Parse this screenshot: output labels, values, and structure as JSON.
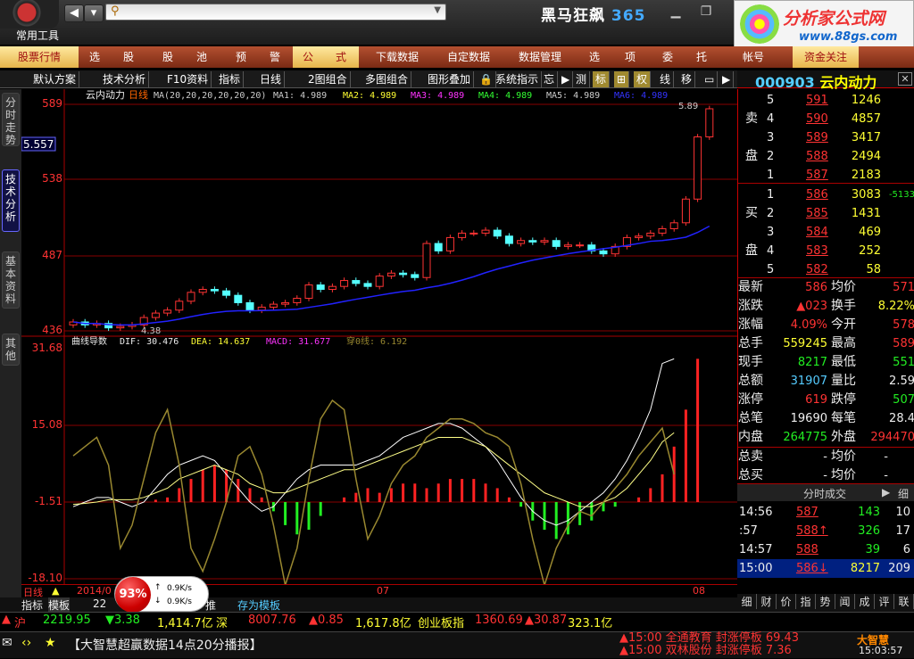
{
  "titlebar": {
    "common_tools": "常用工具",
    "brand_a": "黑马狂飙",
    "brand_b": "365",
    "site_name": "分析家公式网",
    "site_url": "www.88gs.com"
  },
  "menu": [
    "股票行情",
    "选",
    "股",
    "股",
    "池",
    "预",
    "警",
    "公",
    "式",
    "下载数据",
    "自定数据",
    "数据管理",
    "选",
    "项",
    "委",
    "托",
    "帐号",
    "资金关注"
  ],
  "toolbar": [
    "默认方案",
    "技术分析",
    "F10资料",
    "指标",
    "日线",
    "2图组合",
    "多图组合",
    "图形叠加",
    "系统指示",
    "忘",
    "测",
    "标",
    "权",
    "线",
    "移"
  ],
  "left_tabs": [
    "分时走势",
    "技术分析",
    "基本资料",
    "其他"
  ],
  "chart": {
    "name": "云内动力",
    "period": "日线",
    "cursor_price": "5.557",
    "ma_line": [
      "MA(20,20,20,20,20,20)",
      "MA1: 4.989",
      "MA2: 4.989",
      "MA3: 4.989",
      "MA4: 4.989",
      "MA5: 4.989",
      "MA6: 4.989"
    ],
    "price_ticks": [
      "589",
      "538",
      "487",
      "436"
    ],
    "high_label": "5.89",
    "low_label": "4.38",
    "ind_line": [
      "曲线导数",
      "DIF: 30.476",
      "DEA: 14.637",
      "MACD: 31.677",
      "穿0线: 6.192"
    ],
    "ind_ticks": [
      "31.68",
      "15.08",
      "-1.51",
      "-18.10"
    ],
    "date_labels": [
      "2014/0",
      "07",
      "08"
    ],
    "period_label": "日线"
  },
  "speed": {
    "pct": "93%",
    "up": "0.9K/s",
    "down": "0.9K/s"
  },
  "chart_tabs": [
    "指标",
    "模板",
    "22",
    "推",
    "存为模板"
  ],
  "quote": {
    "code": "000903",
    "name": "云内动力",
    "sell_label": [
      "卖",
      "盘"
    ],
    "buy_label": [
      "买",
      "盘"
    ],
    "sell": [
      [
        "5",
        "591",
        "1246"
      ],
      [
        "4",
        "590",
        "4857"
      ],
      [
        "3",
        "589",
        "3417"
      ],
      [
        "2",
        "588",
        "2494"
      ],
      [
        "1",
        "587",
        "2183"
      ]
    ],
    "buy": [
      [
        "1",
        "586",
        "3083",
        "-5133"
      ],
      [
        "2",
        "585",
        "1431"
      ],
      [
        "3",
        "584",
        "469"
      ],
      [
        "4",
        "583",
        "252"
      ],
      [
        "5",
        "582",
        "58"
      ]
    ],
    "stats": [
      [
        "最新",
        "586",
        "均价",
        "571"
      ],
      [
        "涨跌",
        "▲023",
        "换手",
        "8.22%"
      ],
      [
        "涨幅",
        "4.09%",
        "今开",
        "578"
      ],
      [
        "总手",
        "559245",
        "最高",
        "589"
      ],
      [
        "现手",
        "8217",
        "最低",
        "551"
      ],
      [
        "总额",
        "31907",
        "量比",
        "2.59"
      ],
      [
        "涨停",
        "619",
        "跌停",
        "507"
      ],
      [
        "总笔",
        "19690",
        "每笔",
        "28.4"
      ],
      [
        "内盘",
        "264775",
        "外盘",
        "294470"
      ]
    ],
    "order": [
      [
        "总卖",
        "-",
        "均价",
        "-"
      ],
      [
        "总买",
        "-",
        "均价",
        "-"
      ]
    ]
  },
  "trades": {
    "title": "分时成交",
    "tab": "细",
    "rows": [
      [
        "14:56",
        "587",
        "143",
        "10"
      ],
      [
        ":57",
        "588↑",
        "326",
        "17"
      ],
      [
        "14:57",
        "588",
        "39",
        "6"
      ],
      [
        "15:00",
        "586↓",
        "8217",
        "209"
      ]
    ]
  },
  "bottom_tabs": [
    "细",
    "财",
    "价",
    "指",
    "势",
    "闻",
    "成",
    "评",
    "联"
  ],
  "status": {
    "sh_label": "沪",
    "sh": "2219.95",
    "sh_chg": "▼3.38",
    "sh_amt": "1,414.7亿",
    "sz_label": "深",
    "sz": "8007.76",
    "sz_chg": "▲0.85",
    "sz_amt": "1,617.8亿",
    "cy_label": "创业板指",
    "cy": "1360.69",
    "cy_chg": "▲30.87",
    "cy_amt": "323.1亿",
    "news": "【大智慧超赢数据14点20分播报】",
    "alerts": [
      "▲15:00 全通教育 封涨停板 69.43",
      "▲15:00 双林股份 封涨停板 7.36"
    ],
    "logo": "大智慧",
    "time": "15:03:57"
  }
}
